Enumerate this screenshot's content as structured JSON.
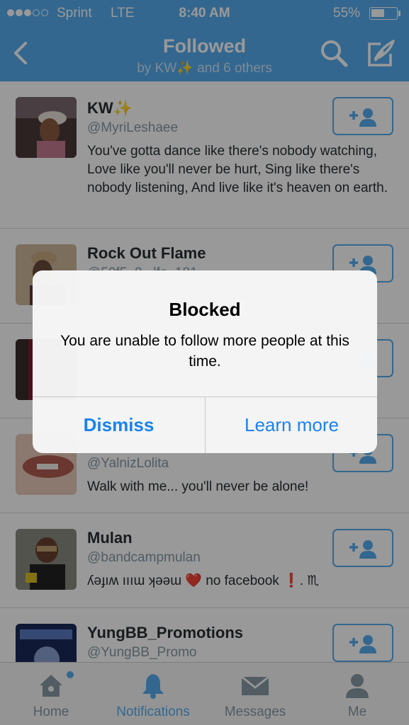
{
  "status_bar": {
    "carrier": "Sprint",
    "network": "LTE",
    "time": "8:40 AM",
    "battery": "55%",
    "battery_level": 0.55
  },
  "nav": {
    "title": "Followed",
    "subtitle": "by KW✨ and 6 others",
    "back_icon": "chevron-left-icon",
    "search_icon": "search-icon",
    "compose_icon": "compose-icon"
  },
  "users": [
    {
      "name": "KW✨",
      "handle": "@MyriLeshaee",
      "bio": "You've gotta dance like there's nobody watching, Love like you'll never be hurt, Sing like there's nobody listening, And live like it's heaven on earth.",
      "avatar_color": "#8a6e63"
    },
    {
      "name": "Rock Out Flame",
      "handle": "@50f5_0...lfe_181",
      "bio": "",
      "avatar_color": "#b08a5a"
    },
    {
      "name": "",
      "handle": "",
      "bio": "",
      "avatar_color": "#7a1e2c"
    },
    {
      "name": "",
      "handle": "@YalnizLolita",
      "bio": "Walk with me... you'll never be alone!",
      "avatar_color": "#c98a7a"
    },
    {
      "name": "Mulan",
      "handle": "@bandcampmulan",
      "bio": "ʎǝɟıʍ ıııɯ ʞǝǝɯ ❤️ no facebook ❗. ♏",
      "avatar_color": "#5a5a4a"
    },
    {
      "name": "YungBB_Promotions",
      "handle": "@YungBB_Promo",
      "bio": "",
      "avatar_color": "#2a4a8a"
    }
  ],
  "alert": {
    "title": "Blocked",
    "message": "You are unable to follow more people at this time.",
    "dismiss": "Dismiss",
    "learn_more": "Learn more"
  },
  "tabs": [
    {
      "label": "Home",
      "icon": "home-icon"
    },
    {
      "label": "Notifications",
      "icon": "bell-icon"
    },
    {
      "label": "Messages",
      "icon": "envelope-icon"
    },
    {
      "label": "Me",
      "icon": "person-icon"
    }
  ],
  "colors": {
    "accent": "#55acee",
    "alert_button": "#1a82f0"
  }
}
